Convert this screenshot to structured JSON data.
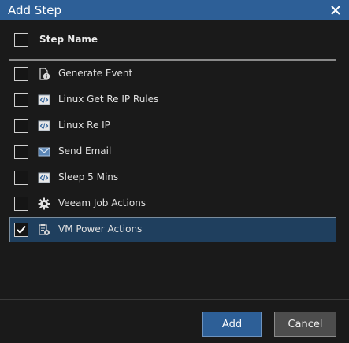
{
  "dialog": {
    "title": "Add Step",
    "close_icon": "close-icon"
  },
  "table": {
    "header": {
      "column": "Step Name",
      "checked": false
    },
    "rows": [
      {
        "label": "Generate Event",
        "icon": "event-icon",
        "checked": false,
        "selected": false
      },
      {
        "label": "Linux Get Re IP Rules",
        "icon": "script-icon",
        "checked": false,
        "selected": false
      },
      {
        "label": "Linux Re IP",
        "icon": "script-icon",
        "checked": false,
        "selected": false
      },
      {
        "label": "Send Email",
        "icon": "email-icon",
        "checked": false,
        "selected": false
      },
      {
        "label": "Sleep 5 Mins",
        "icon": "script-icon",
        "checked": false,
        "selected": false
      },
      {
        "label": "Veeam Job Actions",
        "icon": "gear-icon",
        "checked": false,
        "selected": false
      },
      {
        "label": "VM Power Actions",
        "icon": "power-actions-icon",
        "checked": true,
        "selected": true
      }
    ]
  },
  "buttons": {
    "add": "Add",
    "cancel": "Cancel"
  },
  "colors": {
    "title_bar": "#2d5f97",
    "background": "#1a1a1a",
    "selected_row": "#1f3f5e",
    "add_button": "#2d5f97",
    "cancel_button": "#4d4d4d"
  }
}
